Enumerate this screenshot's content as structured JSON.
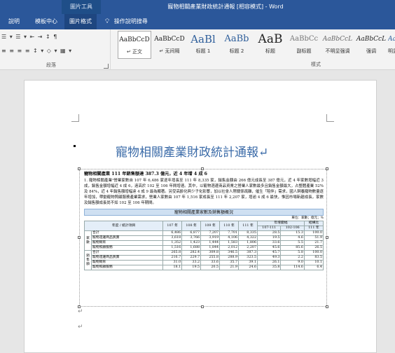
{
  "window": {
    "context_tab": "圖片工具",
    "title": "寵物相關產業財政統計通報 [相容模式] - Word"
  },
  "ribbon_tabs": [
    "說明",
    "模板中心",
    "圖片格式"
  ],
  "tell_me": "操作說明搜尋",
  "paragraph_group": {
    "row1": "☰ ▾  ☰ ▾  ⇤ ⇥  ↕  ¶",
    "row2": "≡ ≡ ≡ ≡  ↕ ▾  ◇ ▾  ▦ ▾",
    "label": "段落"
  },
  "styles_group": {
    "label": "樣式",
    "items": [
      {
        "preview": "AaBbCcD",
        "name": "↵ 正文"
      },
      {
        "preview": "AaBbCcD",
        "name": "↵ 无间隔"
      },
      {
        "preview": "AaBl",
        "name": "标题 1"
      },
      {
        "preview": "AaBb",
        "name": "标题 2"
      },
      {
        "preview": "AaB",
        "name": "标题"
      },
      {
        "preview": "AaBbCc",
        "name": "副标题"
      },
      {
        "preview": "AaBbCcL",
        "name": "不明显强调"
      },
      {
        "preview": "AaBbCcL",
        "name": "强调"
      },
      {
        "preview": "AaBbCcL",
        "name": "明显强"
      }
    ]
  },
  "document": {
    "heading": "寵物相關產業財政統計通報↵",
    "picture": {
      "title": "寵物相關產業 111 年銷售額達 387.3 億元，近 4 年增 4 成 6",
      "paragraph": "1. 寵物相關產業¹營業家數自 107 年 6,486 家逐年增長至 111 年 8,335 家，銷售金額由 266 億元成長至 387 億元，近 4 年家數增幅近 3 成，銷售金額增幅近 4 成 6，遠高於 102 至 106 年間增速。其中，以寵物週邊商品買賣之營業人家數最多且銷售金額最大，占整體產業 52%及 84%，近 4 年銷售額增幅達 4 成 9 最為顯著。另受高齡化與少子化影響，加以社會人際關係疏離，催生「陪伴」需求，國人飼養寵物數量逐年增加，帶動寵物照顧服務產業需求，營業人家數由 107 年 1,516 家成長至 111 年 2,207 家，增逾 4 成 6 最快，惟因市場新趨成長，家數及銷售額成長尚不如 102 至 106 年期間。",
      "table_title": "寵物相關產業家數及銷售額概況",
      "unit": "單位：家數；億元；%",
      "headers": {
        "stub": "年度 / 統計項目",
        "years": [
          "107 年",
          "108 年",
          "109 年",
          "110 年",
          "111 年"
        ],
        "growth": "年增變幅",
        "growth_a": "107-111",
        "growth_b": "102-106",
        "share": "結構比",
        "share_year": "111 年"
      },
      "groups": [
        {
          "name": "家數",
          "rows": [
            {
              "label": "合計",
              "vals": [
                "6,486",
                "6,877",
                "7,207",
                "7,701",
                "8,335",
                "28.5",
                "15.3",
                "100.0"
              ]
            },
            {
              "label": "寵物週邊商品買賣",
              "vals": [
                "3,618",
                "3,766",
                "3,919",
                "4,106",
                "4,322",
                "19.5",
                "4.6",
                "51.9"
              ]
            },
            {
              "label": "寵物飼育",
              "vals": [
                "1,352",
                "1,423",
                "1,444",
                "1,583",
                "1,806",
                "33.6",
                "5.5",
                "21.7"
              ]
            },
            {
              "label": "寵物照顧服務",
              "vals": [
                "1,516",
                "1,688",
                "1,844",
                "2,012",
                "2,207",
                "45.6",
                "85.6",
                "26.5"
              ]
            }
          ]
        },
        {
          "name": "銷售額",
          "rows": [
            {
              "label": "合計",
              "vals": [
                "265.8",
                "282.4",
                "309.8",
                "346.5",
                "387.3",
                "45.7",
                "5.8",
                "100.0"
              ]
            },
            {
              "label": "寵物週邊商品買賣",
              "vals": [
                "216.7",
                "229.7",
                "255.8",
                "288.9",
                "323.5",
                "49.3",
                "2.2",
                "83.5"
              ]
            },
            {
              "label": "寵物飼育",
              "vals": [
                "31.0",
                "33.2",
                "33.6",
                "35.7",
                "39.1",
                "26.1",
                "9.0",
                "10.1"
              ]
            },
            {
              "label": "寵物照顧服務",
              "vals": [
                "18.1",
                "19.5",
                "20.5",
                "21.9",
                "24.6",
                "35.8",
                "114.6",
                "6.4"
              ]
            }
          ]
        }
      ]
    },
    "para_mark_1": "↵",
    "para_mark_2": "↵"
  }
}
